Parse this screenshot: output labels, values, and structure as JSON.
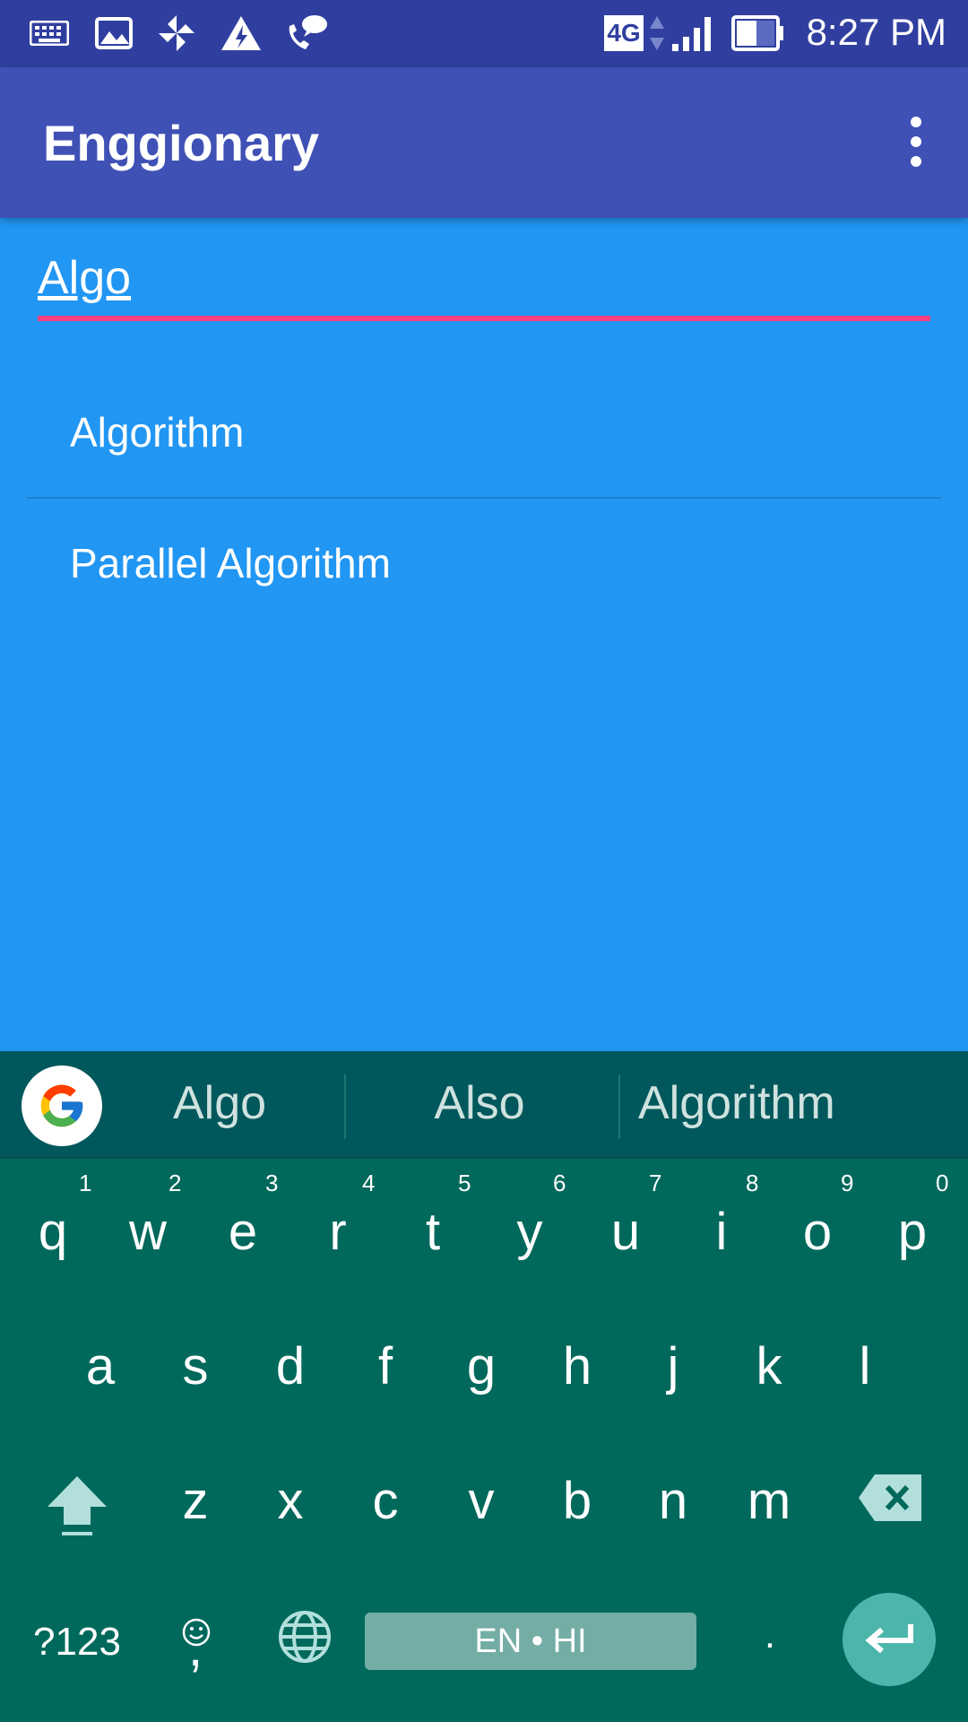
{
  "status_bar": {
    "icons": [
      "keyboard-icon",
      "image-icon",
      "pinwheel-icon",
      "warning-icon",
      "phone-message-icon"
    ],
    "network": "4G",
    "time": "8:27 PM"
  },
  "app_bar": {
    "title": "Enggionary",
    "menu_icon": "more-vert-icon"
  },
  "search": {
    "value": "Algo",
    "underline_color": "#FF4081"
  },
  "results": [
    {
      "label": "Algorithm"
    },
    {
      "label": "Parallel Algorithm"
    }
  ],
  "keyboard": {
    "suggestions": [
      "Algo",
      "Also",
      "Algorithm"
    ],
    "row1": [
      "q",
      "w",
      "e",
      "r",
      "t",
      "y",
      "u",
      "i",
      "o",
      "p"
    ],
    "row1_hints": [
      "1",
      "2",
      "3",
      "4",
      "5",
      "6",
      "7",
      "8",
      "9",
      "0"
    ],
    "row2": [
      "a",
      "s",
      "d",
      "f",
      "g",
      "h",
      "j",
      "k",
      "l"
    ],
    "row3": [
      "z",
      "x",
      "c",
      "v",
      "b",
      "n",
      "m"
    ],
    "symbols_label": "?123",
    "comma_label": ",",
    "period_label": ".",
    "space_label": "EN • HI"
  },
  "colors": {
    "status_bar": "#303F9F",
    "app_bar": "#3F51B5",
    "background": "#2196F3",
    "keyboard": "#00695C",
    "accent": "#FF4081"
  }
}
